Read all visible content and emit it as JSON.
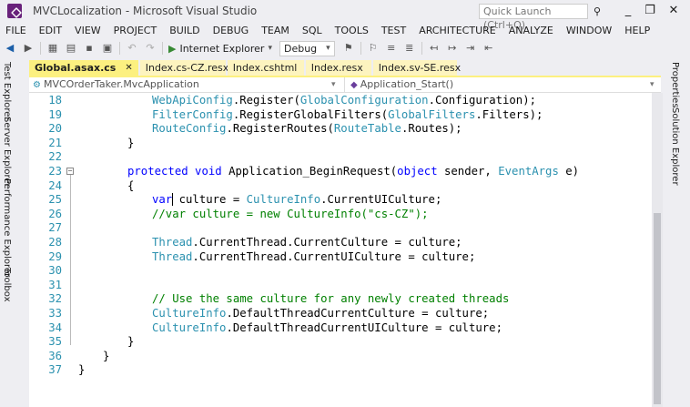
{
  "window": {
    "title": "MVCLocalization - Microsoft Visual Studio",
    "quick_launch_placeholder": "Quick Launch (Ctrl+Q)",
    "minimize": "_",
    "restore": "❐",
    "close": "✕"
  },
  "menu": [
    "FILE",
    "EDIT",
    "VIEW",
    "PROJECT",
    "BUILD",
    "DEBUG",
    "TEAM",
    "SQL",
    "TOOLS",
    "TEST",
    "ARCHITECTURE",
    "ANALYZE",
    "WINDOW",
    "HELP"
  ],
  "toolbar": {
    "run_label": "Internet Explorer",
    "config_label": "Debug"
  },
  "left_tools": [
    "Test Explorer",
    "Server Explorer",
    "Performance Explorer",
    "Toolbox"
  ],
  "right_tools": [
    "Properties",
    "Solution Explorer"
  ],
  "tabs": [
    {
      "label": "Global.asax.cs",
      "active": true,
      "closable": true
    },
    {
      "label": "Index.cs-CZ.resx",
      "active": false,
      "closable": false
    },
    {
      "label": "Index.cshtml",
      "active": false,
      "closable": false
    },
    {
      "label": "Index.resx",
      "active": false,
      "closable": false
    },
    {
      "label": "Index.sv-SE.resx",
      "active": false,
      "closable": false
    }
  ],
  "navbar": {
    "class_path": "MVCOrderTaker.MvcApplication",
    "member": "Application_Start()"
  },
  "code_lines": [
    {
      "num": "18",
      "indent": 3,
      "parts": [
        [
          "ty",
          "WebApiConfig"
        ],
        [
          "",
          "."
        ],
        [
          "",
          "Register("
        ],
        [
          "ty",
          "GlobalConfiguration"
        ],
        [
          "",
          ".Configuration);"
        ]
      ]
    },
    {
      "num": "19",
      "indent": 3,
      "parts": [
        [
          "ty",
          "FilterConfig"
        ],
        [
          "",
          ".RegisterGlobalFilters("
        ],
        [
          "ty",
          "GlobalFilters"
        ],
        [
          "",
          ".Filters);"
        ]
      ]
    },
    {
      "num": "20",
      "indent": 3,
      "parts": [
        [
          "ty",
          "RouteConfig"
        ],
        [
          "",
          ".RegisterRoutes("
        ],
        [
          "ty",
          "RouteTable"
        ],
        [
          "",
          ".Routes);"
        ]
      ]
    },
    {
      "num": "21",
      "indent": 2,
      "parts": [
        [
          "",
          "}"
        ]
      ]
    },
    {
      "num": "22",
      "indent": 0,
      "parts": []
    },
    {
      "num": "23",
      "indent": 2,
      "fold": true,
      "parts": [
        [
          "kw",
          "protected"
        ],
        [
          "",
          " "
        ],
        [
          "kw",
          "void"
        ],
        [
          "",
          " Application_BeginRequest("
        ],
        [
          "kw",
          "object"
        ],
        [
          "",
          " sender, "
        ],
        [
          "ty",
          "EventArgs"
        ],
        [
          "",
          " e)"
        ]
      ]
    },
    {
      "num": "24",
      "indent": 2,
      "parts": [
        [
          "",
          "{"
        ]
      ]
    },
    {
      "num": "25",
      "indent": 3,
      "parts": [
        [
          "kw",
          "var"
        ],
        [
          "",
          " culture = "
        ],
        [
          "ty",
          "CultureInfo"
        ],
        [
          "",
          ".CurrentUICulture;"
        ]
      ]
    },
    {
      "num": "26",
      "indent": 3,
      "parts": [
        [
          "cm",
          "//var culture = new CultureInfo(\"cs-CZ\");"
        ]
      ]
    },
    {
      "num": "27",
      "indent": 0,
      "parts": []
    },
    {
      "num": "28",
      "indent": 3,
      "parts": [
        [
          "ty",
          "Thread"
        ],
        [
          "",
          ".CurrentThread.CurrentCulture = culture;"
        ]
      ]
    },
    {
      "num": "29",
      "indent": 3,
      "parts": [
        [
          "ty",
          "Thread"
        ],
        [
          "",
          ".CurrentThread.CurrentUICulture = culture;"
        ]
      ]
    },
    {
      "num": "30",
      "indent": 0,
      "parts": []
    },
    {
      "num": "31",
      "indent": 0,
      "parts": []
    },
    {
      "num": "32",
      "indent": 3,
      "parts": [
        [
          "cm",
          "// Use the same culture for any newly created threads"
        ]
      ]
    },
    {
      "num": "33",
      "indent": 3,
      "parts": [
        [
          "ty",
          "CultureInfo"
        ],
        [
          "",
          ".DefaultThreadCurrentCulture = culture;"
        ]
      ]
    },
    {
      "num": "34",
      "indent": 3,
      "parts": [
        [
          "ty",
          "CultureInfo"
        ],
        [
          "",
          ".DefaultThreadCurrentUICulture = culture;"
        ]
      ]
    },
    {
      "num": "35",
      "indent": 2,
      "parts": [
        [
          "",
          "}"
        ]
      ]
    },
    {
      "num": "36",
      "indent": 1,
      "parts": [
        [
          "",
          "}"
        ]
      ]
    },
    {
      "num": "37",
      "indent": 0,
      "parts": [
        [
          "",
          "}"
        ]
      ]
    }
  ]
}
